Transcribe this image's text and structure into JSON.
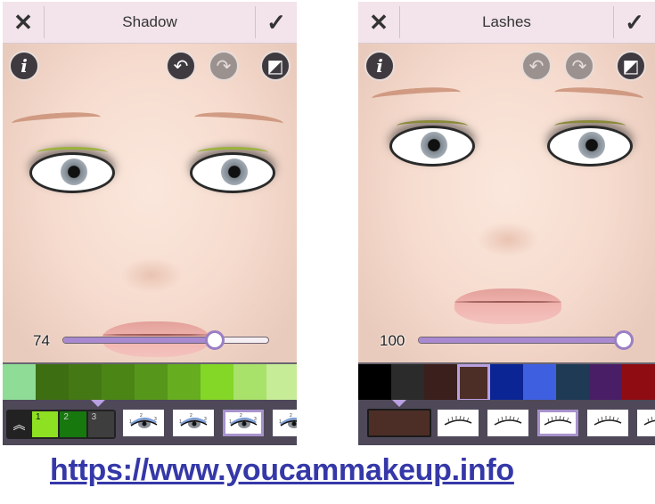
{
  "panels": {
    "left": {
      "title": "Shadow",
      "close_icon": "close-icon",
      "confirm_icon": "checkmark-icon",
      "toolbar": {
        "info": "i",
        "undo_enabled": true,
        "redo_enabled": false,
        "compare_icon": "compare-icon"
      },
      "slider": {
        "label": "74",
        "value": 74,
        "max": 100
      },
      "swatches": [
        "#8fdc96",
        "#3d6e12",
        "#447814",
        "#4b8516",
        "#56961a",
        "#66ad20",
        "#84d726",
        "#a9e26a",
        "#c6ec97"
      ],
      "selected_swatch": -1,
      "layers": [
        {
          "label": "1",
          "color": "#8de022"
        },
        {
          "label": "2",
          "color": "#17780e"
        },
        {
          "label": "3",
          "color": "#3e3e3e"
        }
      ],
      "expand_icon": "double-chevron-up-icon",
      "patterns": [
        {
          "name": "eyeshadow-pattern-1",
          "selected": false
        },
        {
          "name": "eyeshadow-pattern-2",
          "selected": false
        },
        {
          "name": "eyeshadow-pattern-3",
          "selected": true
        },
        {
          "name": "eyeshadow-pattern-4",
          "selected": false
        }
      ]
    },
    "right": {
      "title": "Lashes",
      "close_icon": "close-icon",
      "confirm_icon": "checkmark-icon",
      "toolbar": {
        "info": "i",
        "undo_enabled": false,
        "redo_enabled": false,
        "compare_icon": "compare-icon"
      },
      "slider": {
        "label": "100",
        "value": 100,
        "max": 100
      },
      "swatches": [
        "#000000",
        "#2a2b2a",
        "#3a1f1c",
        "#4d2e27",
        "#0b2594",
        "#3e5fe0",
        "#1f3a55",
        "#4a1e66",
        "#8e0c12"
      ],
      "selected_swatch": 3,
      "selected_color": "#4d2e27",
      "patterns": [
        {
          "name": "lash-pattern-1",
          "selected": false
        },
        {
          "name": "lash-pattern-2",
          "selected": false
        },
        {
          "name": "lash-pattern-3",
          "selected": true
        },
        {
          "name": "lash-pattern-4",
          "selected": false
        },
        {
          "name": "lash-pattern-5",
          "selected": false
        }
      ]
    }
  },
  "footer": {
    "link_text": "https://www.youcammakeup.info"
  },
  "colors": {
    "accent": "#a98ad0",
    "topbar": "#f2e4ea",
    "bottombar": "#4e4858",
    "link": "#3538a8"
  }
}
